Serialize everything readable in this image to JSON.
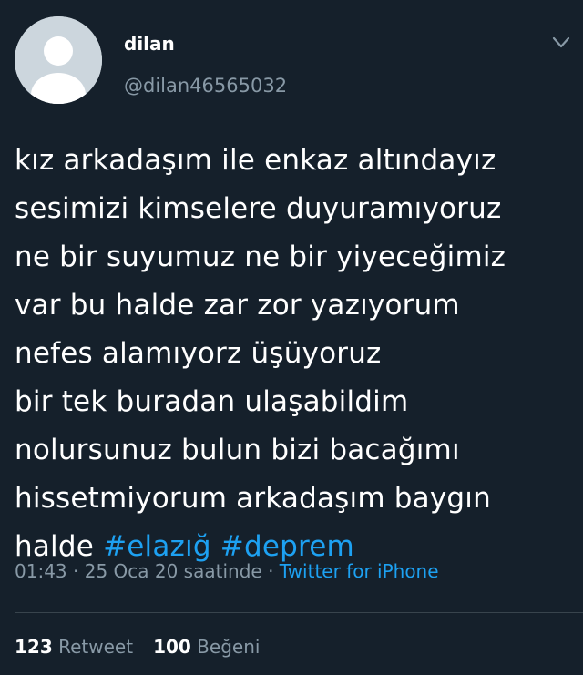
{
  "author": {
    "display_name": "dilan",
    "handle": "@dilan46565032"
  },
  "tweet": {
    "lines": [
      "kız arkadaşım ile enkaz altındayız",
      "sesimizi kimselere duyuramıyoruz",
      "ne bir suyumuz ne bir yiyeceğimiz",
      "var bu halde zar zor yazıyorum",
      "nefes alamıyorz üşüyoruz",
      "bir tek buradan ulaşabildim",
      "nolursunuz bulun bizi bacağımı",
      "hissetmiyorum arkadaşım baygın"
    ],
    "last_line_text": "halde",
    "hashtags": [
      "#elazığ",
      "#deprem"
    ]
  },
  "meta": {
    "time": "01:43",
    "separator": "·",
    "date": "25 Oca 20 saatinde",
    "source": "Twitter for iPhone"
  },
  "stats": {
    "retweets_count": "123",
    "retweets_label": "Retweet",
    "likes_count": "100",
    "likes_label": "Beğeni"
  },
  "colors": {
    "background": "#15202b",
    "text": "#ffffff",
    "secondary": "#8899a6",
    "link": "#1da1f2",
    "divider": "#38444d"
  },
  "icons": {
    "avatar": "default-profile-avatar",
    "menu": "chevron-down-icon"
  }
}
